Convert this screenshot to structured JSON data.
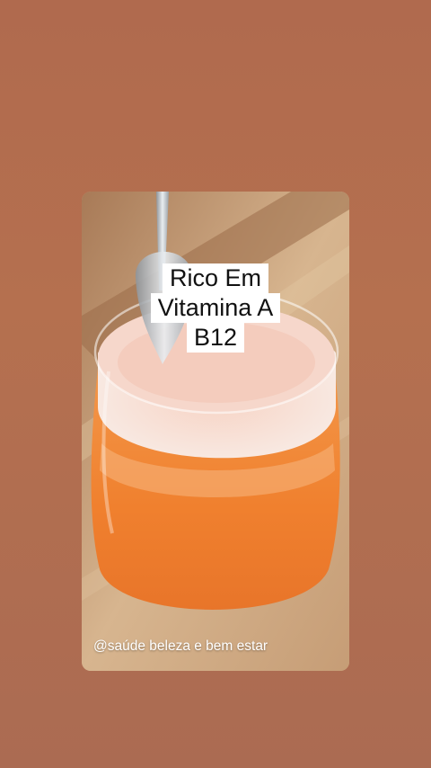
{
  "post": {
    "caption_lines": [
      "Rico Em",
      "Vitamina A",
      "B12"
    ],
    "credit": "@saúde beleza e bem estar"
  },
  "colors": {
    "background": "#b06a4e",
    "juice": "#f28a3a",
    "foam": "#f6e4dc"
  },
  "icons": {
    "photo": "juice-glass-photo"
  }
}
